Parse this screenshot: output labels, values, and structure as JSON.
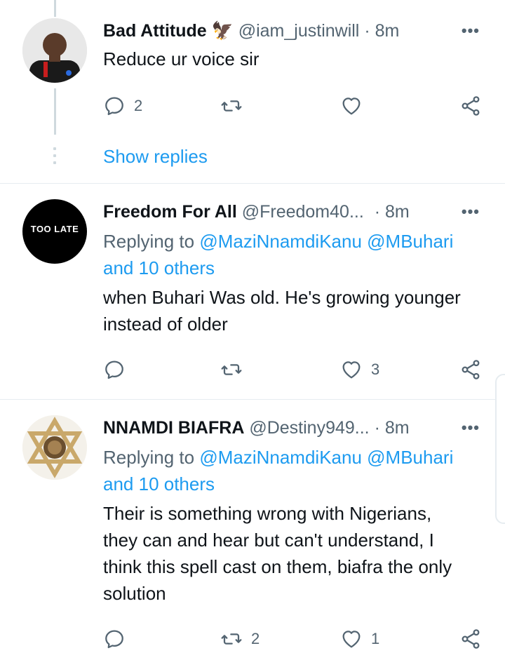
{
  "tweets": [
    {
      "name": "Bad Attitude",
      "name_emoji": "🦅",
      "handle": "@iam_justinwill",
      "time": "8m",
      "more": "•••",
      "text": "Reduce ur voice sir",
      "reply_count": "2",
      "retweet_count": "",
      "like_count": "",
      "show_replies": "Show replies"
    },
    {
      "name": "Freedom For All",
      "handle": "@Freedom40...",
      "time": "8m",
      "more": "•••",
      "replying_prefix": "Replying to",
      "mention_1": "@MaziNnamdiKanu",
      "mention_2": "@MBuhari",
      "mention_3": "and 10 others",
      "text_line1": "when Buhari Was old. He's growing younger",
      "text_line2": "instead of older",
      "avatar_text": "TOO LATE",
      "reply_count": "",
      "retweet_count": "",
      "like_count": "3"
    },
    {
      "name": "NNAMDI BIAFRA",
      "handle": "@Destiny949...",
      "time": "8m",
      "more": "•••",
      "replying_prefix": "Replying to",
      "mention_1": "@MaziNnamdiKanu",
      "mention_2": "@MBuhari",
      "mention_3": "and 10 others",
      "text_line1": "Their is something wrong with Nigerians,",
      "text_line2": "they can and hear but can't understand, I",
      "text_line3": "think this spell cast on them, biafra the only",
      "text_line4": "solution",
      "reply_count": "",
      "retweet_count": "2",
      "like_count": "1"
    }
  ],
  "colors": {
    "link": "#1d9bf0",
    "secondary": "#536471",
    "primary": "#0f1419",
    "divider": "#e6ecf0"
  }
}
